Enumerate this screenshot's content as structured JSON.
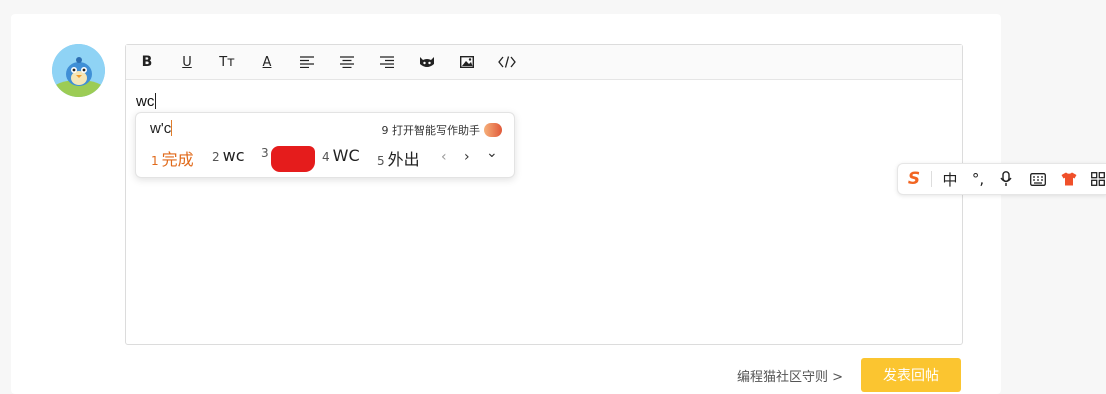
{
  "editor": {
    "typed_text": "wc",
    "toolbar": {
      "bold": "B",
      "underline": "U",
      "text_size": "Tт",
      "font_color": "A"
    }
  },
  "ime_popup": {
    "composition": "w'c",
    "assistant_label": "9 打开智能写作助手",
    "candidates": [
      {
        "num": "1",
        "text": "完成"
      },
      {
        "num": "2",
        "text": "wc"
      },
      {
        "num": "3",
        "text": ""
      },
      {
        "num": "4",
        "text": "WC"
      },
      {
        "num": "5",
        "text": "外出"
      }
    ],
    "prev": "‹",
    "next": "›",
    "expand": "⌄"
  },
  "ime_toolbar": {
    "logo": "S",
    "mode": "中",
    "punct": "°,"
  },
  "footer": {
    "rules_link": "编程猫社区守则 >",
    "submit_label": "发表回帖"
  },
  "colors": {
    "accent": "#fbc530",
    "candidate_selected": "#e06a1b",
    "ime_logo": "#f26522"
  }
}
